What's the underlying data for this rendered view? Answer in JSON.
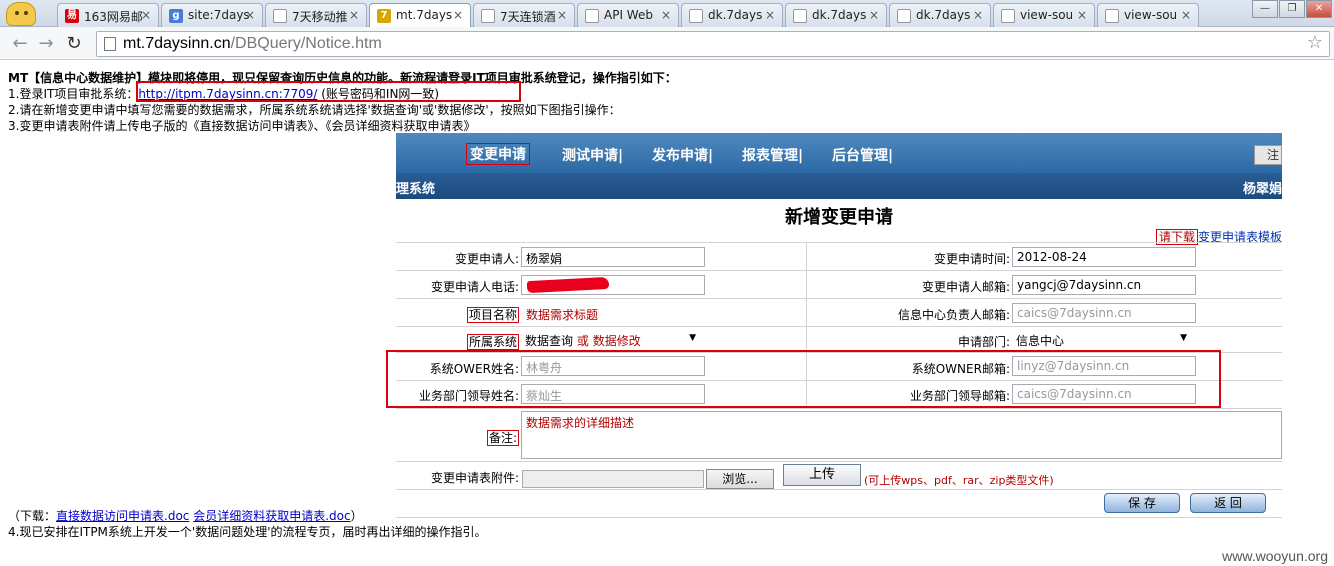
{
  "browser": {
    "tabs": [
      {
        "label": "163网易邮",
        "fav": "易",
        "fav_color": "#d8000a"
      },
      {
        "label": "site:7days",
        "fav": "g",
        "fav_color": "#4b7cd4"
      },
      {
        "label": "7天移动推",
        "fav": "",
        "fav_color": "#ffffff"
      },
      {
        "label": "mt.7days",
        "fav": "7",
        "fav_color": "#d4a800"
      },
      {
        "label": "7天连锁酒",
        "fav": "",
        "fav_color": "#ffffff"
      },
      {
        "label": "API Web",
        "fav": "",
        "fav_color": "#ffffff"
      },
      {
        "label": "dk.7days",
        "fav": "",
        "fav_color": "#ffffff"
      },
      {
        "label": "dk.7days",
        "fav": "",
        "fav_color": "#ffffff"
      },
      {
        "label": "dk.7days",
        "fav": "",
        "fav_color": "#ffffff"
      },
      {
        "label": "view-sou",
        "fav": "",
        "fav_color": "#ffffff"
      },
      {
        "label": "view-sou",
        "fav": "",
        "fav_color": "#ffffff"
      }
    ],
    "url_host": "mt.7daysinn.cn",
    "url_path": "/DBQuery/Notice.htm"
  },
  "notice": {
    "line0": "MT【信息中心数据维护】模块即将停用，现只保留查询历史信息的功能。新流程请登录IT项目审批系统登记，操作指引如下：",
    "line1_prefix": "1.登录IT项目审批系统：",
    "line1_link": "http://itpm.7daysinn.cn:7709/",
    "line1_suffix": "(账号密码和IN网一致)",
    "line2": "2.请在新增变更申请中填写您需要的数据需求，所属系统系统请选择'数据查询'或'数据修改'，按照如下图指引操作：",
    "line3": "3.变更申请表附件请上传电子版的《直接数据访问申请表》、《会员详细资料获取申请表》",
    "download_prefix": "（下载：",
    "download_link1": "直接数据访问申请表.doc",
    "download_link2": "会员详细资料获取申请表.doc",
    "download_suffix": "）",
    "line4": "4.现已安排在ITPM系统上开发一个'数据问题处理'的流程专页，届时再出详细的操作指引。"
  },
  "app": {
    "nav": [
      "变更申请",
      "测试申请|",
      "发布申请|",
      "报表管理|",
      "后台管理|"
    ],
    "logout": "注",
    "system_title": "理系统",
    "user_name": "杨翠娟",
    "form_title": "新增变更申请",
    "download_req": "请下载",
    "download_template": "变更申请表模板",
    "fields": {
      "applicant_label": "变更申请人:",
      "applicant_value": "杨翠娟",
      "apply_time_label": "变更申请时间:",
      "apply_time_value": "2012-08-24",
      "phone_label": "变更申请人电话:",
      "email_label": "变更申请人邮箱:",
      "email_value": "yangcj@7daysinn.cn",
      "project_label": "项目名称",
      "project_value": "数据需求标题",
      "info_email_label": "信息中心负责人邮箱:",
      "info_email_value": "caics@7daysinn.cn",
      "system_label": "所属系统",
      "system_value_a": "数据查询",
      "system_or": "或",
      "system_value_b": "数据修改",
      "dept_label": "申请部门:",
      "dept_value": "信息中心",
      "owner_name_label": "系统OWER姓名:",
      "owner_name_value": "林粤舟",
      "owner_email_label": "系统OWNER邮箱:",
      "owner_email_value": "linyz@7daysinn.cn",
      "leader_name_label": "业务部门领导姓名:",
      "leader_name_value": "蔡灿生",
      "leader_email_label": "业务部门领导邮箱:",
      "leader_email_value": "caics@7daysinn.cn",
      "remark_label": "备注:",
      "remark_value": "数据需求的详细描述",
      "attach_label": "变更申请表附件:",
      "browse": "浏览...",
      "upload": "上传",
      "upload_hint": "(可上传wps、pdf、rar、zip类型文件)"
    },
    "save": "保 存",
    "back": "返 回"
  },
  "watermark": "www.wooyun.org"
}
